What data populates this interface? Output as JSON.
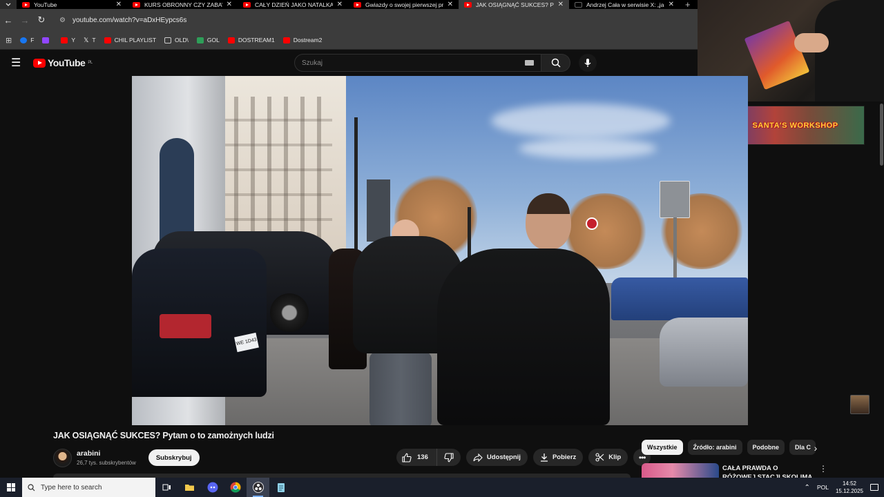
{
  "browser": {
    "tabs": [
      {
        "title": "YouTube",
        "icon": "youtube-icon"
      },
      {
        "title": "KURS OBRONNY CZY ZABAWA",
        "icon": "youtube-icon"
      },
      {
        "title": "CAŁY DZIEŃ JAKO NATALKA!! (I",
        "icon": "youtube-icon"
      },
      {
        "title": "Gwiazdy o swojej pierwszej pra",
        "icon": "youtube-icon"
      },
      {
        "title": "JAK OSIĄGNĄĆ SUKCES? Pytam",
        "icon": "youtube-icon",
        "active": true
      },
      {
        "title": "Andrzej Cała w serwisie X: „ja ju",
        "icon": "x-icon"
      }
    ],
    "url": "youtube.com/watch?v=aDxHEypcs6s",
    "bookmarks": [
      {
        "label": "F",
        "icon": "facebook-icon"
      },
      {
        "label": "",
        "icon": "twitch-icon"
      },
      {
        "label": "Y",
        "icon": "youtube-icon"
      },
      {
        "label": "T",
        "icon": "x-icon"
      },
      {
        "label": "CHIL PLAYLIST",
        "icon": "youtube-icon"
      },
      {
        "label": "OLD\\",
        "icon": "folder-icon"
      },
      {
        "label": "GOL",
        "icon": "gol-icon"
      },
      {
        "label": "DOSTREAM1",
        "icon": "youtube-icon"
      },
      {
        "label": "Dostream2",
        "icon": "youtube-icon"
      }
    ]
  },
  "youtube": {
    "logo_text": "YouTube",
    "region": "PL",
    "search_placeholder": "Szukaj"
  },
  "overlay": {
    "banner_text": "SANTA'S WORKSHOP"
  },
  "video": {
    "title": "JAK OSIĄGNĄĆ SUKCES? Pytam o to zamożnych ludzi",
    "plate_text": "WE 1D43"
  },
  "channel": {
    "name": "arabini",
    "subscribers": "26,7 tys. subskrybentów",
    "subscribe_label": "Subskrybuj"
  },
  "actions": {
    "likes": "136",
    "share_label": "Udostępnij",
    "download_label": "Pobierz",
    "clip_label": "Klip"
  },
  "sidebar": {
    "chips": [
      "Wszystkie",
      "Źródło: arabini",
      "Podobne",
      "Dla C"
    ],
    "recommendation": {
      "title": "CAŁA PRAWDA O RÓŻOWEJ STACJI SKOLIMA -"
    }
  },
  "taskbar": {
    "search_placeholder": "Type here to search",
    "language": "POL",
    "time": "14:52",
    "date": "15.12.2025"
  },
  "colors": {
    "youtube_red": "#ff0000",
    "background": "#0f0f0f",
    "chip_active": "#f1f1f1",
    "taskbar": "#1a1f2b"
  }
}
